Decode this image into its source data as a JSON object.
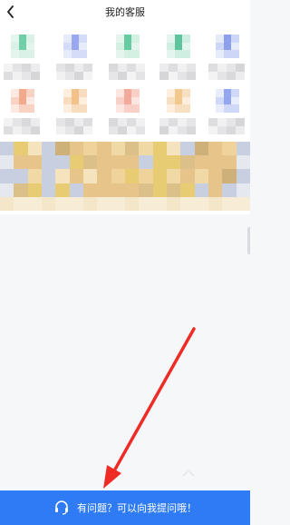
{
  "header": {
    "title": "我的客服",
    "back_icon": "chevron-left-icon"
  },
  "categories_row1": [
    {
      "icon_colors": [
        "#e5f5ee",
        "#6fd0a7",
        "#d9f1e6"
      ]
    },
    {
      "icon_colors": [
        "#e7ecfb",
        "#9aa9ef",
        "#d4dcf7"
      ]
    },
    {
      "icon_colors": [
        "#e5f5ee",
        "#67cba2",
        "#d4f0e3"
      ]
    },
    {
      "icon_colors": [
        "#e4f4ee",
        "#5fc59e",
        "#cfeee2"
      ]
    },
    {
      "icon_colors": [
        "#e6ebfa",
        "#8ea0ec",
        "#cdd6f6"
      ]
    }
  ],
  "categories_row2": [
    {
      "icon_colors": [
        "#fde9e1",
        "#f3a98c",
        "#f8d3c3"
      ]
    },
    {
      "icon_colors": [
        "#fdeedd",
        "#f4c289",
        "#f7dcc0"
      ]
    },
    {
      "icon_colors": [
        "#fde6e1",
        "#f3a99b",
        "#f8d0c8"
      ]
    },
    {
      "icon_colors": [
        "#fdeedd",
        "#f2c88f",
        "#f7dfc2"
      ]
    },
    {
      "icon_colors": [
        "#e9ecfb",
        "#93a6ee",
        "#cfd8f6"
      ]
    }
  ],
  "banner_colors": {
    "base": "#f1d9a6",
    "alt": "#e7c489",
    "dark": "#cdb178",
    "accent": "#e8cc73",
    "blue": "#c8cfe0"
  },
  "bottom_bar": {
    "label": "有问题？可以向我提问哦！",
    "icon": "headset-icon",
    "color": "#2f7bf5"
  },
  "annotation": {
    "arrow_color": "#ef2b26"
  }
}
